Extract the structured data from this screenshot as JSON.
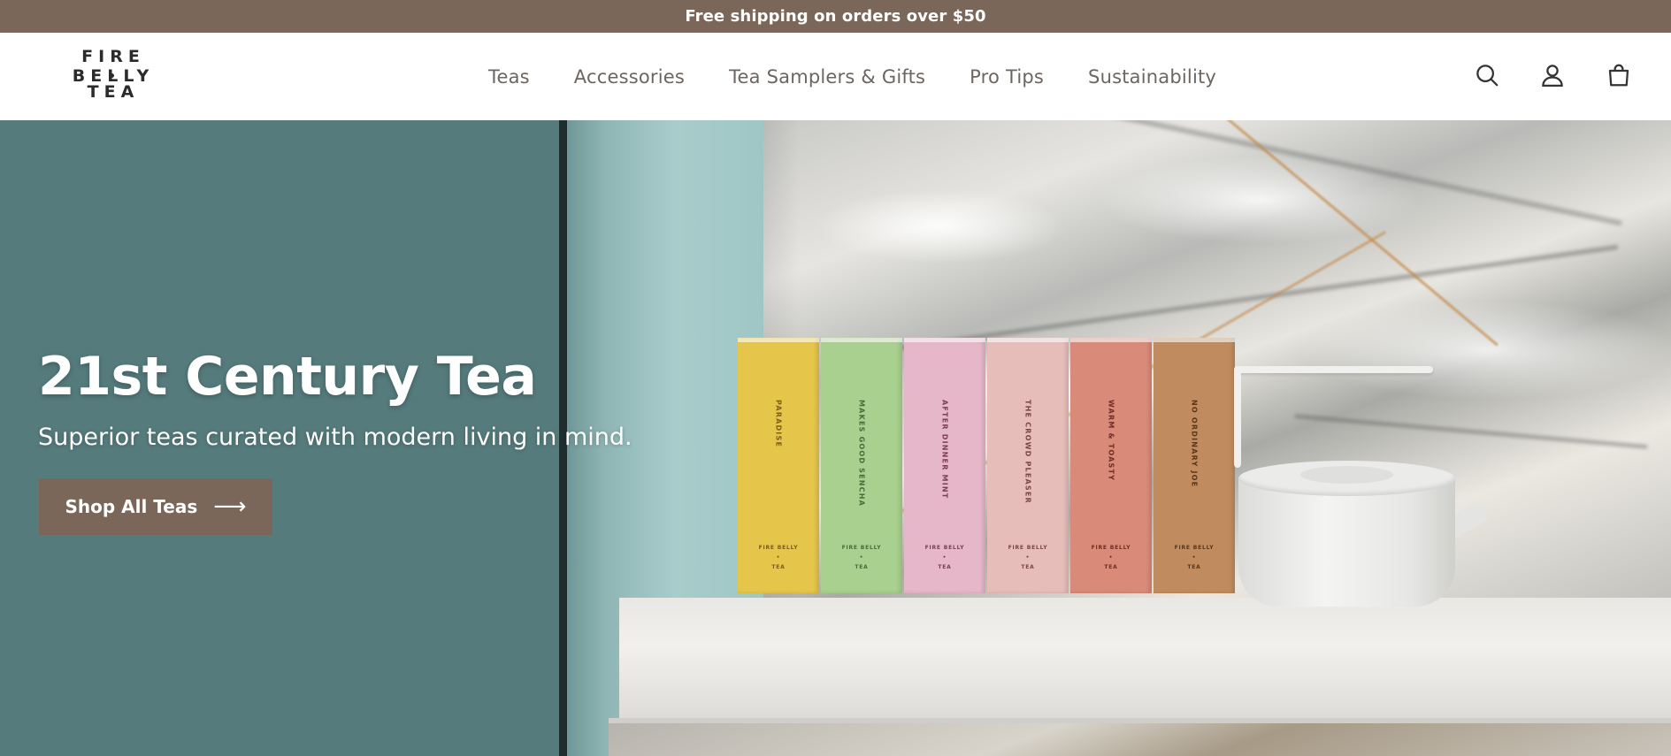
{
  "announcement": {
    "text": "Free shipping on orders over $50"
  },
  "logo": {
    "line1": "FIRE BELLY",
    "line2": "TEA"
  },
  "nav": {
    "items": [
      {
        "label": "Teas"
      },
      {
        "label": "Accessories"
      },
      {
        "label": "Tea Samplers & Gifts"
      },
      {
        "label": "Pro Tips"
      },
      {
        "label": "Sustainability"
      }
    ]
  },
  "header_icons": [
    "search-icon",
    "account-icon",
    "cart-icon"
  ],
  "hero": {
    "title": "21st Century Tea",
    "subtitle": "Superior teas curated with modern living in mind.",
    "button_label": "Shop All Teas",
    "boxes": [
      {
        "name": "PARADISE",
        "color": "#e5c64a",
        "text_color": "#7a5d14"
      },
      {
        "name": "MAKES GOOD SENCHA",
        "color": "#a9d08f",
        "text_color": "#4a6a3a"
      },
      {
        "name": "AFTER DINNER MINT",
        "color": "#e6b7c9",
        "text_color": "#7a3d55"
      },
      {
        "name": "THE CROWD PLEASER",
        "color": "#e6bdb9",
        "text_color": "#7a4545"
      },
      {
        "name": "WARM & TOASTY",
        "color": "#d98a78",
        "text_color": "#6e2d22"
      },
      {
        "name": "NO ORDINARY JOE",
        "color": "#c08c5f",
        "text_color": "#5a3618"
      }
    ],
    "box_brand_line1": "FIRE BELLY",
    "box_brand_line2": "TEA"
  },
  "colors": {
    "brand_brown": "#7b6759",
    "hero_teal": "#557b7c",
    "nav_text": "#6d6561"
  }
}
